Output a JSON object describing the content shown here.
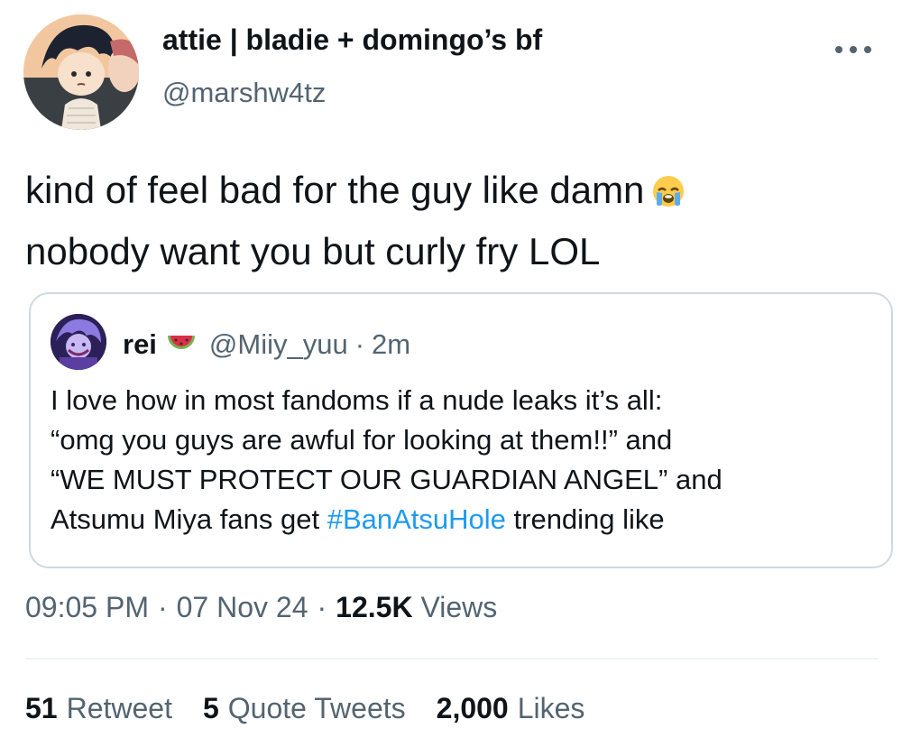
{
  "author": {
    "name": "attie | bladie + domingo’s bf",
    "handle": "@marshw4tz"
  },
  "tweet": {
    "lines": [
      "kind of feel bad for the guy like damn",
      "nobody want you but curly fry LOL"
    ],
    "emoji": "loudly-crying-face"
  },
  "quote": {
    "name": "rei",
    "name_emoji": "watermelon",
    "handle": "@Miiy_yuu",
    "separator": "·",
    "time": "2m",
    "lines": [
      "I love how in most fandoms if a nude leaks it’s all:",
      "“omg you guys are awful for looking at them!!” and",
      "“WE MUST PROTECT OUR GUARDIAN ANGEL” and"
    ],
    "last_line_prefix": "Atsumu Miya fans get",
    "hashtag": "#BanAtsuHole",
    "last_line_suffix": "trending like"
  },
  "meta": {
    "time": "09:05 PM",
    "separator": "·",
    "date": "07 Nov 24",
    "views_count": "12.5K",
    "views_label": "Views"
  },
  "stats": {
    "retweets_count": "51",
    "retweets_label": "Retweet",
    "quotes_count": "5",
    "quotes_label": "Quote Tweets",
    "likes_count": "2,000",
    "likes_label": "Likes"
  },
  "colors": {
    "text": "#0f1419",
    "secondary": "#536471",
    "link": "#1d9bf0",
    "border": "#cfd9de"
  }
}
